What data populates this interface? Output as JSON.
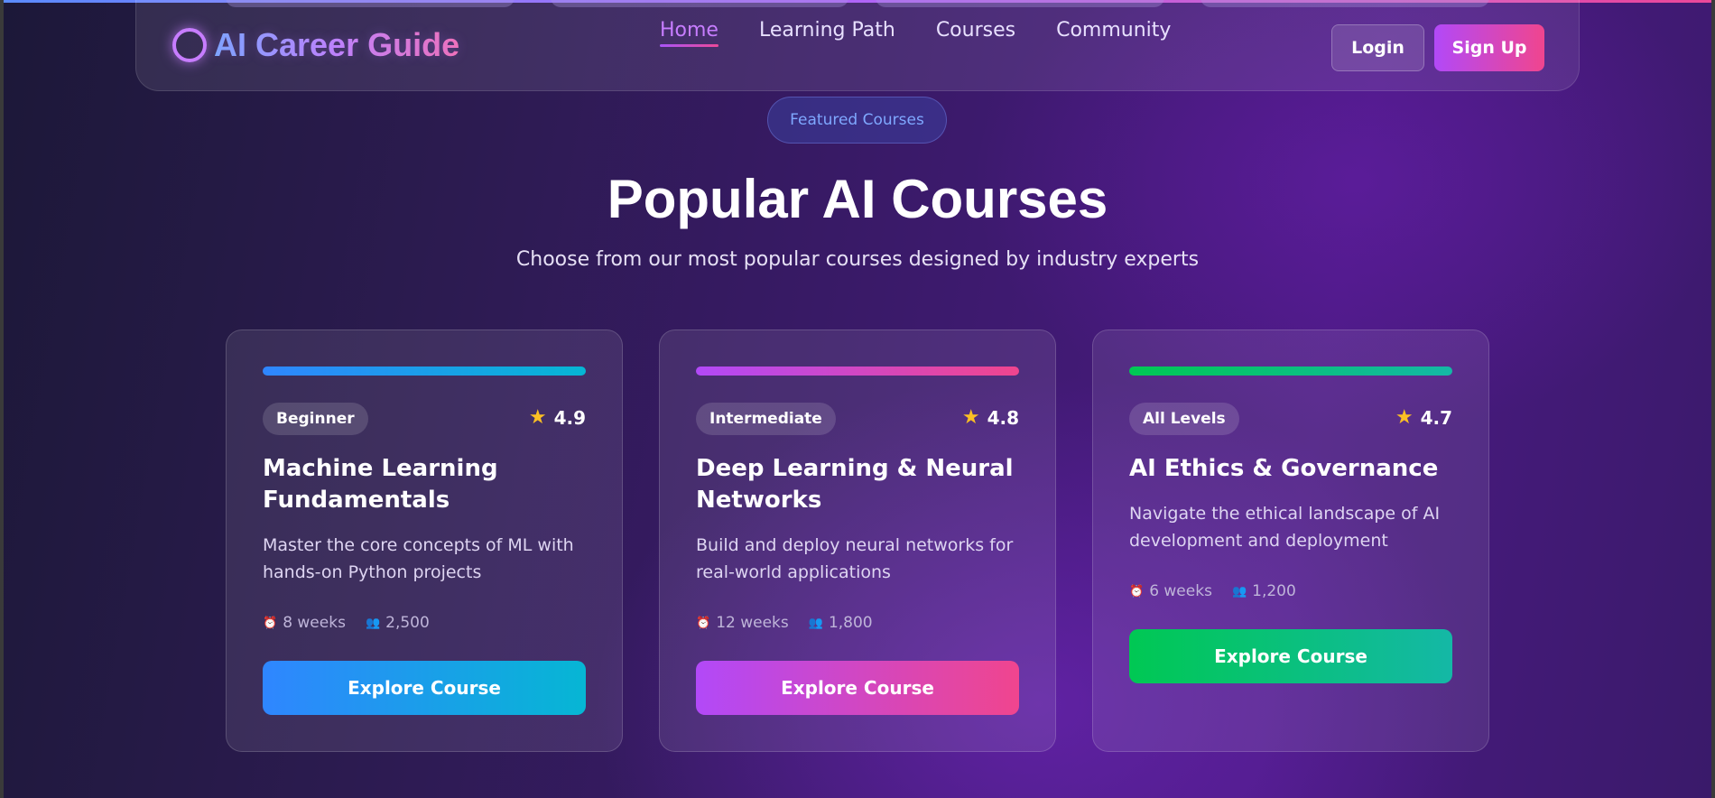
{
  "header": {
    "logo_text": "AI Career Guide",
    "nav": [
      "Home",
      "Learning Path",
      "Courses",
      "Community"
    ],
    "login_label": "Login",
    "signup_label": "Sign Up"
  },
  "section": {
    "badge": "Featured Courses",
    "title": "Popular AI Courses",
    "subtitle": "Choose from our most popular courses designed by industry experts"
  },
  "courses": [
    {
      "level": "Beginner",
      "rating": "4.9",
      "title": "Machine Learning Fundamentals",
      "description": "Master the core concepts of ML with hands-on Python projects",
      "duration": "8 weeks",
      "students": "2,500",
      "button": "Explore Course",
      "accent_from": "#2f86ff",
      "accent_to": "#06b6d4"
    },
    {
      "level": "Intermediate",
      "rating": "4.8",
      "title": "Deep Learning & Neural Networks",
      "description": "Build and deploy neural networks for real-world applications",
      "duration": "12 weeks",
      "students": "1,800",
      "button": "Explore Course",
      "accent_from": "#b249f8",
      "accent_to": "#f0458e"
    },
    {
      "level": "All Levels",
      "rating": "4.7",
      "title": "AI Ethics & Governance",
      "description": "Navigate the ethical landscape of AI development and deployment",
      "duration": "6 weeks",
      "students": "1,200",
      "button": "Explore Course",
      "accent_from": "#00c853",
      "accent_to": "#14b8a6"
    }
  ]
}
